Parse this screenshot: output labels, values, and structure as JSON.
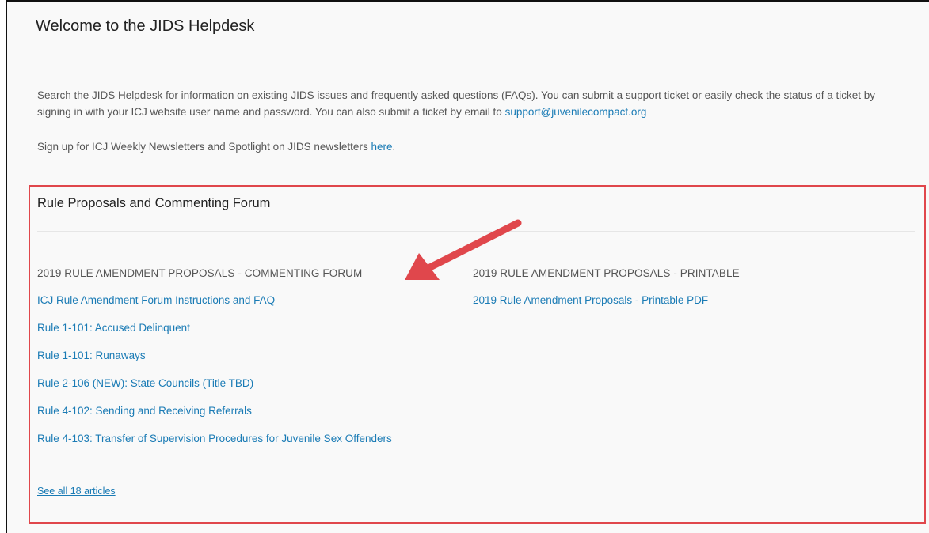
{
  "header": {
    "title": "Welcome to the JIDS Helpdesk"
  },
  "intro": {
    "text": "Search the JIDS Helpdesk for information on existing JIDS issues and frequently asked questions (FAQs). You can submit a support ticket or easily check the status of a ticket by signing in with your ICJ website user name and password. You can also submit a ticket by email to ",
    "email_link": "support@juvenilecompact.org"
  },
  "newsletter": {
    "text": "Sign up for ICJ Weekly Newsletters and Spotlight on JIDS newsletters ",
    "link": "here",
    "suffix": "."
  },
  "forum": {
    "title": "Rule Proposals and Commenting Forum",
    "left_heading": "2019 RULE AMENDMENT PROPOSALS - COMMENTING FORUM",
    "left_articles": [
      "ICJ Rule Amendment Forum Instructions and FAQ",
      "Rule 1-101: Accused Delinquent",
      "Rule 1-101: Runaways",
      "Rule 2-106 (NEW): State Councils (Title TBD)",
      "Rule 4-102: Sending and Receiving Referrals",
      "Rule 4-103: Transfer of Supervision Procedures for Juvenile Sex Offenders"
    ],
    "see_all": "See all 18 articles",
    "right_heading": "2019 RULE AMENDMENT PROPOSALS - PRINTABLE",
    "right_articles": [
      "2019 Rule Amendment Proposals - Printable PDF"
    ]
  },
  "colors": {
    "link": "#1a7bb5",
    "highlight_border": "#e0474c",
    "arrow": "#e0474c"
  }
}
